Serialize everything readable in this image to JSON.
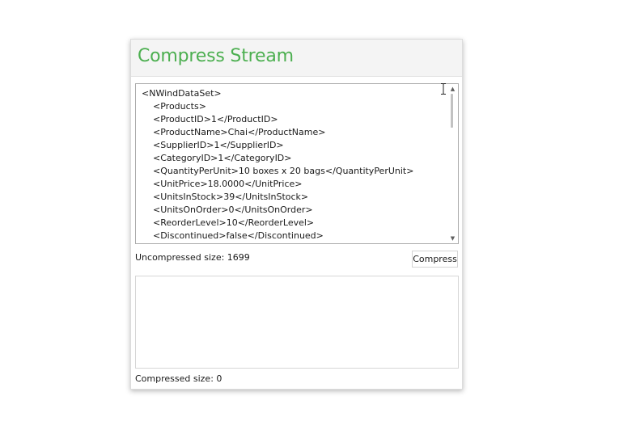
{
  "window": {
    "title": "Compress Stream",
    "accent_color": "#4caf50"
  },
  "xml_editor": {
    "lines": [
      "<NWindDataSet>",
      "<Products>",
      "<ProductID>1</ProductID>",
      "<ProductName>Chai</ProductName>",
      "<SupplierID>1</SupplierID>",
      "<CategoryID>1</CategoryID>",
      "<QuantityPerUnit>10 boxes x 20 bags</QuantityPerUnit>",
      "<UnitPrice>18.0000</UnitPrice>",
      "<UnitsInStock>39</UnitsInStock>",
      "<UnitsOnOrder>0</UnitsOnOrder>",
      "<ReorderLevel>10</ReorderLevel>",
      "<Discontinued>false</Discontinued>"
    ],
    "scroll_up_icon": "triangle-up-icon",
    "scroll_down_icon": "triangle-down-icon"
  },
  "stats": {
    "uncompressed_label": "Uncompressed size: 1699",
    "compressed_label": "Compressed size: 0"
  },
  "actions": {
    "compress_label": "Compress"
  },
  "output": {
    "value": ""
  }
}
